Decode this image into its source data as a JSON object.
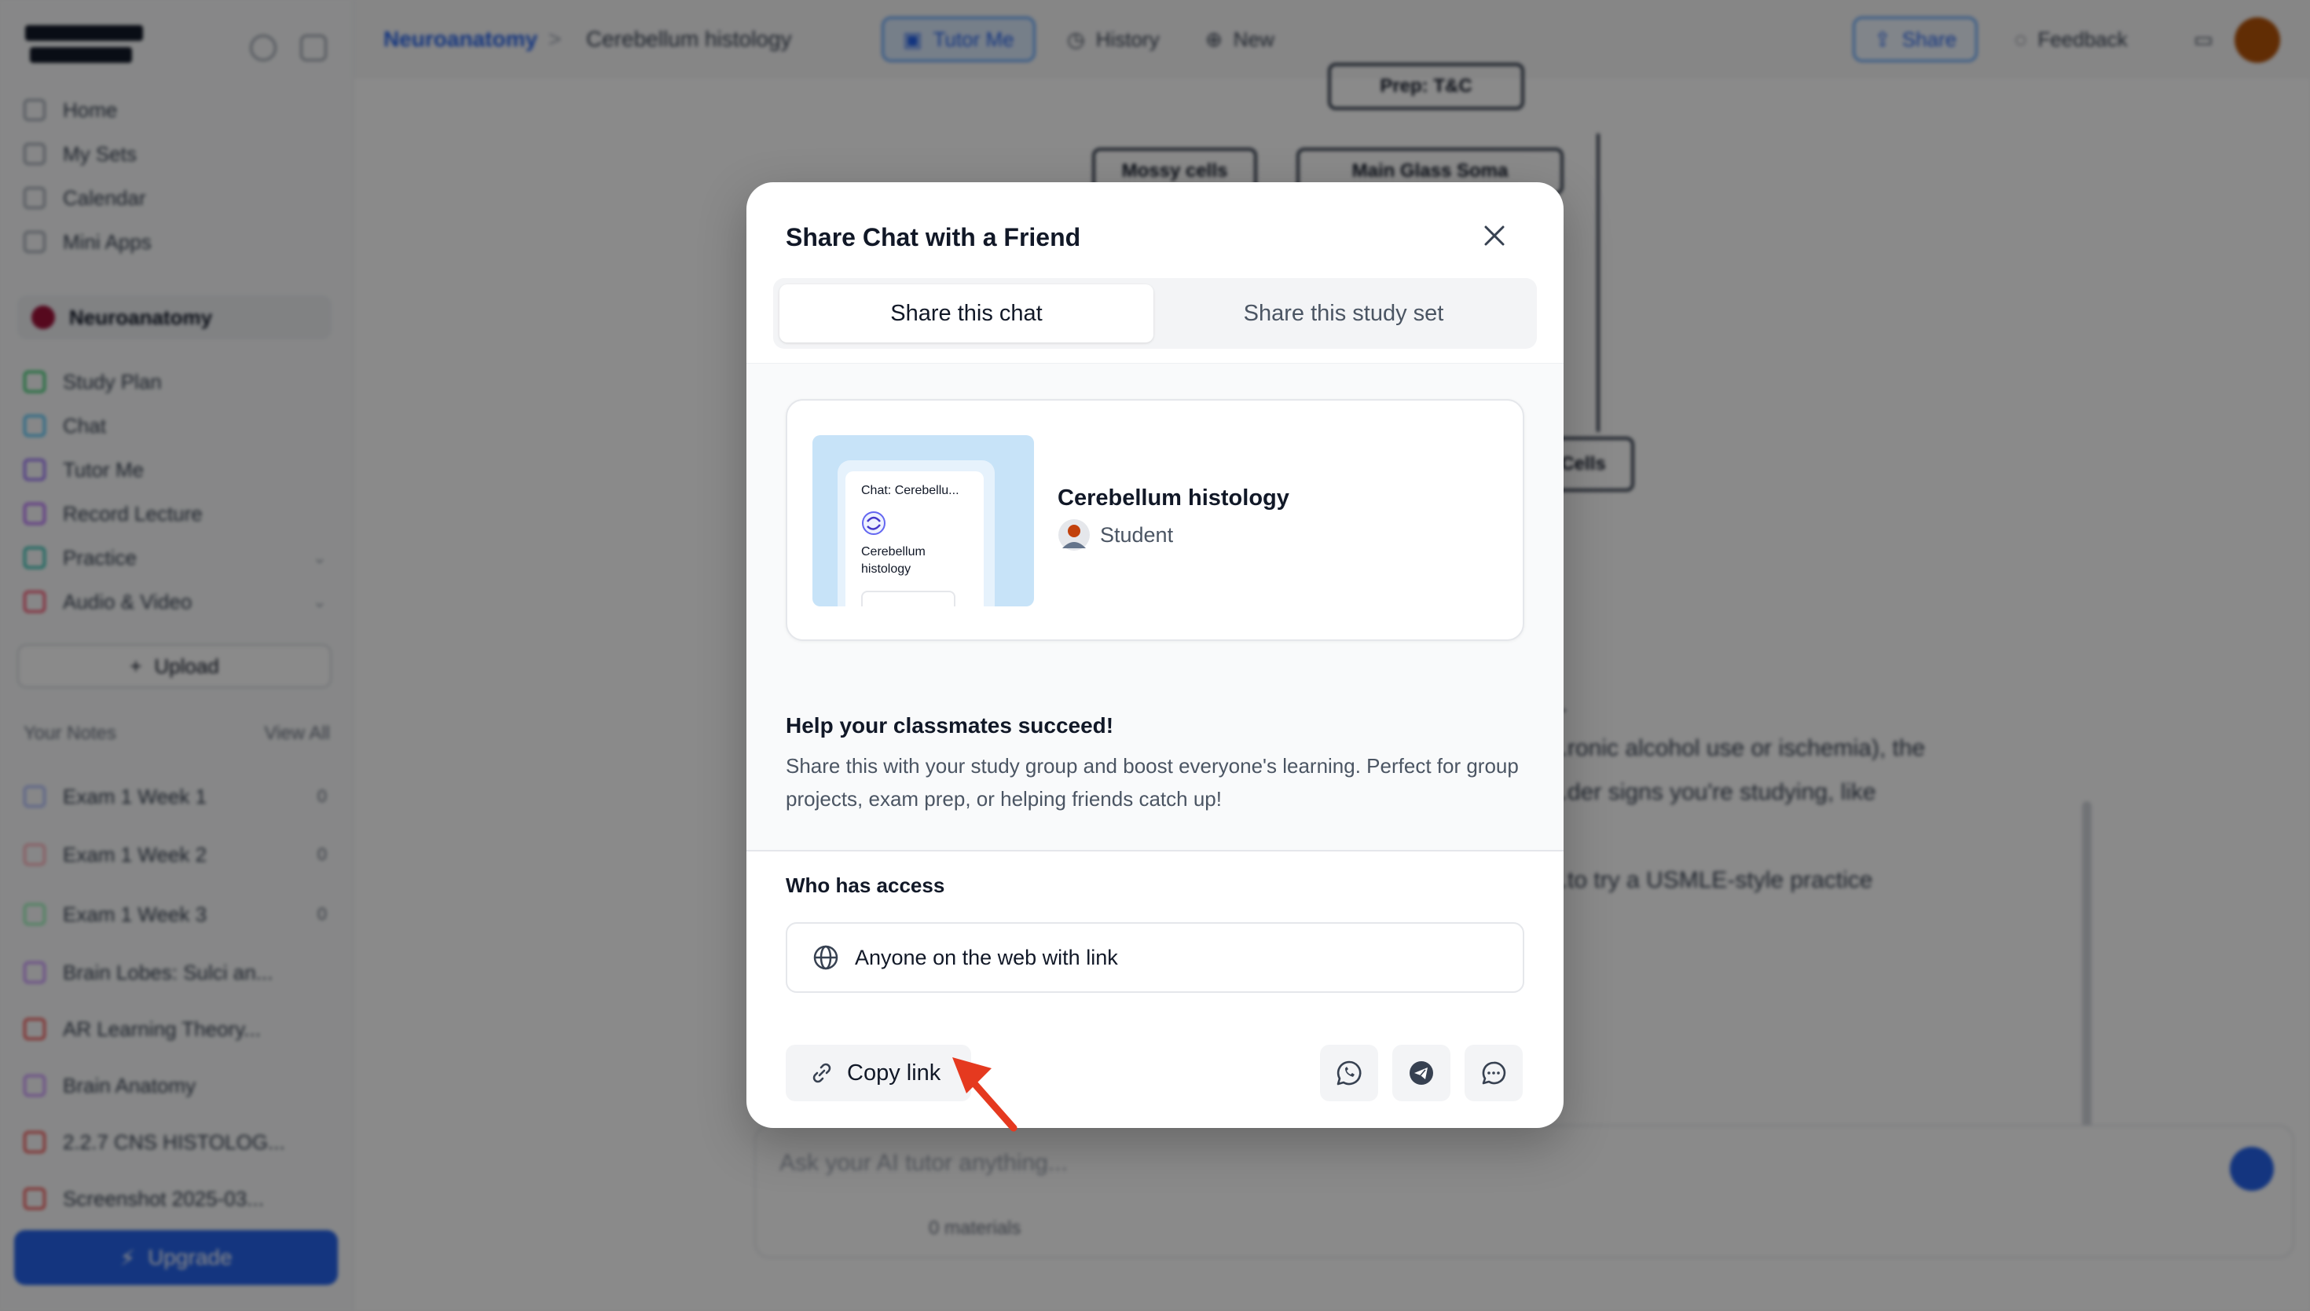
{
  "sidebar": {
    "nav": [
      {
        "label": "Home"
      },
      {
        "label": "My Sets"
      },
      {
        "label": "Calendar"
      },
      {
        "label": "Mini Apps"
      }
    ],
    "section": {
      "label": "Neuroanatomy"
    },
    "tools": [
      {
        "label": "Study Plan",
        "color": "#22c55e"
      },
      {
        "label": "Chat",
        "color": "#38bdf8"
      },
      {
        "label": "Tutor Me",
        "color": "#8b5cf6"
      },
      {
        "label": "Record Lecture",
        "color": "#a855f7"
      },
      {
        "label": "Practice",
        "color": "#14b8a6"
      },
      {
        "label": "Audio & Video",
        "color": "#f43f5e"
      }
    ],
    "upload_label": "Upload",
    "notes_header": "Your Notes",
    "notes_sort": "View All",
    "notes": [
      {
        "label": "Exam 1 Week 1",
        "count": "0"
      },
      {
        "label": "Exam 1 Week 2",
        "count": "0"
      },
      {
        "label": "Exam 1 Week 3",
        "count": "0"
      },
      {
        "label": "Brain Lobes: Sulci an..."
      },
      {
        "label": "AR Learning Theory..."
      },
      {
        "label": "Brain Anatomy"
      },
      {
        "label": "2.2.7 CNS HISTOLOG..."
      },
      {
        "label": "Screenshot 2025-03..."
      }
    ],
    "cta_label": "Upgrade"
  },
  "topbar": {
    "crumb_root": "Neuroanatomy",
    "crumb_sep": ">",
    "crumb_current": "Cerebellum histology",
    "tutor_label": "Tutor Me",
    "history_label": "History",
    "new_label": "New",
    "share_label": "Share",
    "feedback_label": "Feedback"
  },
  "background": {
    "flow": {
      "top": "Prep: T&C",
      "left": "Mossy cells",
      "right": "Main Glass Soma",
      "bottom": "Cells"
    },
    "lines": [
      "...",
      "...ronic alcohol use or ischemia), the",
      "...der signs you're studying, like",
      "...to try a USMLE-style practice"
    ],
    "input_placeholder": "Ask your AI tutor anything...",
    "input_chip": "0 materials"
  },
  "modal": {
    "title": "Share Chat with a Friend",
    "tabs": [
      {
        "label": "Share this chat",
        "active": true
      },
      {
        "label": "Share this study set",
        "active": false
      }
    ],
    "preview": {
      "thumb_title": "Chat: Cerebellu...",
      "thumb_subtitle": "Cerebellum histology",
      "title": "Cerebellum histology",
      "role": "Student"
    },
    "help_title": "Help your classmates succeed!",
    "help_text": "Share this with your study group and boost everyone's learning. Perfect for group projects, exam prep, or helping friends catch up!",
    "access_label": "Who has access",
    "access_value": "Anyone on the web with link",
    "copy_label": "Copy link",
    "share_icons": [
      "whatsapp-icon",
      "telegram-icon",
      "message-icon"
    ]
  },
  "colors": {
    "accent": "#2563eb",
    "annotation_arrow": "#e5391f",
    "overlay": "rgba(0,0,0,0.46)"
  }
}
